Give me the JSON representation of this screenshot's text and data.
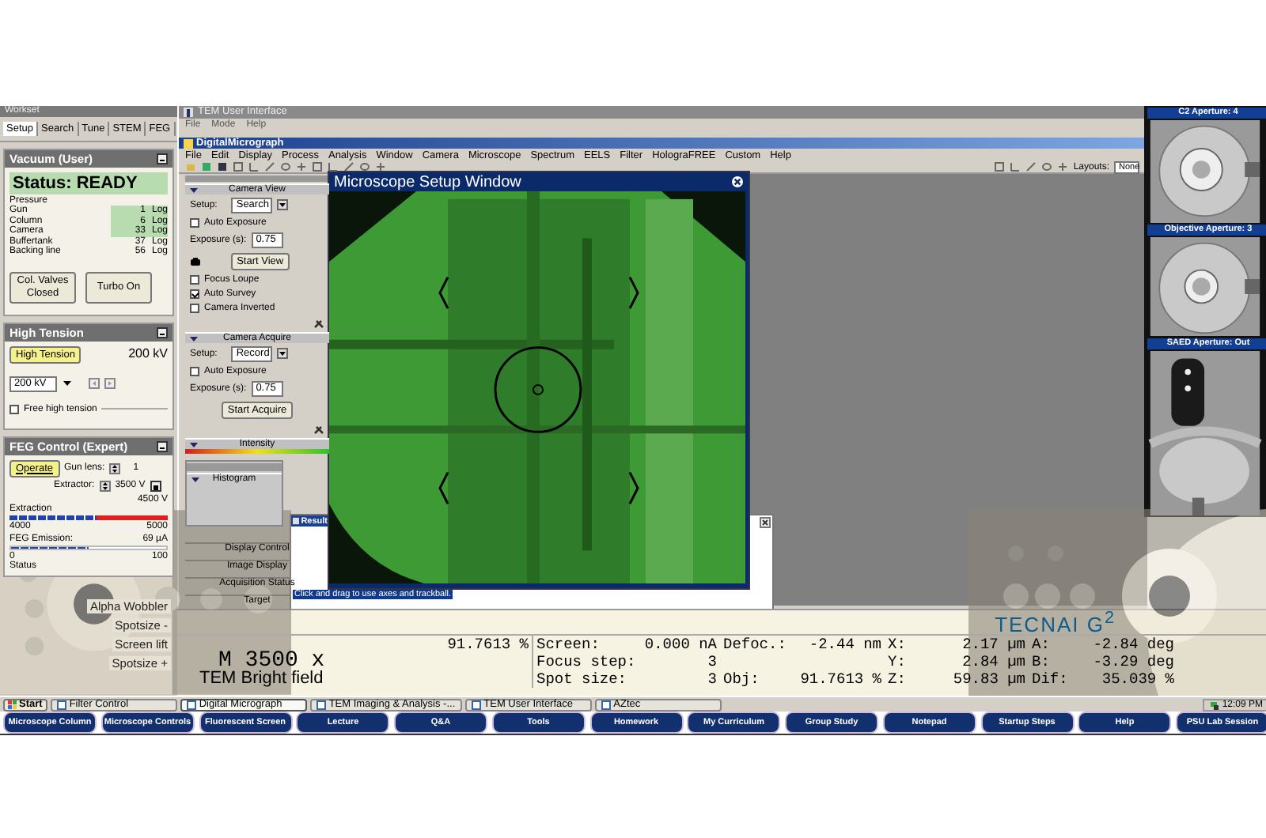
{
  "workset": {
    "title": "Workset",
    "tabs": [
      {
        "label": "Setup",
        "selected": true
      },
      {
        "label": "Search",
        "selected": false
      },
      {
        "label": "Tune",
        "selected": false
      },
      {
        "label": "STEM",
        "selected": false
      },
      {
        "label": "FEG",
        "selected": false
      }
    ]
  },
  "vacuum": {
    "title": "Vacuum (User)",
    "status": "Status:  READY",
    "pressure_label": "Pressure",
    "gauges": [
      {
        "name": "Gun",
        "value": "1",
        "unit": "Log",
        "highlighted": true
      },
      {
        "name": "Column",
        "value": "6",
        "unit": "Log",
        "highlighted": true
      },
      {
        "name": "Camera",
        "value": "33",
        "unit": "Log",
        "highlighted": true
      },
      {
        "name": "Buffertank",
        "value": "37",
        "unit": "Log",
        "highlighted": false
      },
      {
        "name": "Backing line",
        "value": "56",
        "unit": "Log",
        "highlighted": false
      }
    ],
    "buttons": [
      "Col. Valves Closed",
      "Turbo On"
    ]
  },
  "high_tension": {
    "title": "High Tension",
    "button": {
      "label": "High Tension",
      "on": true
    },
    "reading": "200 kV",
    "select": "200 kV",
    "free_tension": {
      "label": "Free high tension",
      "checked": false
    }
  },
  "feg": {
    "title": "FEG Control (Expert)",
    "operate": {
      "label": "Operate",
      "on": true
    },
    "gun_lens_label": "Gun lens:",
    "gun_lens": "1",
    "extractor_label": "Extractor:",
    "extractor": "3500 V",
    "extraction_max": "4500 V",
    "extraction": {
      "label": "Extraction",
      "level": 0.55,
      "min": "4000",
      "max": "5000"
    },
    "emission": {
      "label": "FEG Emission:",
      "reading": "69 µA",
      "level": 0.5,
      "min": "0",
      "max": "100"
    },
    "status_label": "Status",
    "flap_buttons": [
      "Alpha Wobbler",
      "Spotsize -",
      "Screen lift",
      "Spotsize +"
    ]
  },
  "tem_ui": {
    "title": "TEM User Interface",
    "menu": [
      "File",
      "Mode",
      "Help"
    ]
  },
  "dm": {
    "title": "DigitalMicrograph",
    "menu": [
      "File",
      "Edit",
      "Display",
      "Process",
      "Analysis",
      "Window",
      "Camera",
      "Microscope",
      "Spectrum",
      "EELS",
      "Filter",
      "HolograFREE",
      "Custom",
      "Help"
    ],
    "layouts_label": "Layouts:",
    "layout": "None",
    "camera_view": {
      "title": "Camera View",
      "setup_label": "Setup:",
      "setup": "Search",
      "exposure_label": "Exposure (s):",
      "exposure": "0.75",
      "button": "Start View",
      "checks": [
        {
          "label": "Auto Exposure",
          "checked": false,
          "kind": "top"
        },
        {
          "label": "Focus Loupe",
          "checked": false,
          "kind": "bottom"
        },
        {
          "label": "Auto Survey",
          "checked": true,
          "kind": "bottom"
        },
        {
          "label": "Camera Inverted",
          "checked": false,
          "kind": "bottom"
        }
      ]
    },
    "camera_acquire": {
      "title": "Camera Acquire",
      "setup_label": "Setup:",
      "setup": "Record",
      "exposure_label": "Exposure (s):",
      "exposure": "0.75",
      "button": "Start Acquire",
      "checks": [
        {
          "label": "Auto Exposure",
          "checked": false,
          "kind": "top"
        }
      ]
    },
    "intensity_title": "Intensity",
    "histogram_title": "Histogram",
    "palettes": [
      "Display Control",
      "Image Display",
      "Acquisition Status",
      "Target"
    ]
  },
  "setup_window": {
    "title": "Microscope Setup Window"
  },
  "result_window": {
    "title": "Result",
    "hint": "Click and drag to use axes and trackball."
  },
  "apertures": [
    {
      "label": "C2 Aperture: 4"
    },
    {
      "label": "Objective Aperture: 3"
    },
    {
      "label": "SAED Aperture: Out"
    }
  ],
  "readout": {
    "brand": "TECNAI G$^{2}$",
    "magnification": "M 3500 x",
    "mode": "TEM Bright field",
    "intensity": "91.7613 %",
    "rows": [
      [
        {
          "label": "Screen:",
          "value": "0.000 nA"
        },
        {
          "label": "Defoc.:",
          "value": "-2.44 nm"
        },
        {
          "label": "X:",
          "value": "2.17 µm"
        },
        {
          "label": "A:",
          "value": "-2.84 deg"
        }
      ],
      [
        {
          "label": "Focus step:",
          "value": "3"
        },
        null,
        {
          "label": "Y:",
          "value": "2.84 µm"
        },
        {
          "label": "B:",
          "value": "-3.29 deg"
        }
      ],
      [
        {
          "label": "Spot size:",
          "value": "3"
        },
        {
          "label": "Obj:",
          "value": "91.7613 %"
        },
        {
          "label": "Z:",
          "value": "59.83 µm"
        },
        {
          "label": "Dif:",
          "value": "35.039 %"
        }
      ]
    ]
  },
  "taskbar": {
    "start": "Start",
    "tasks": [
      {
        "label": "Filter Control",
        "selected": false
      },
      {
        "label": "Digital Micrograph",
        "selected": true
      },
      {
        "label": "TEM Imaging & Analysis -...",
        "selected": false
      },
      {
        "label": "TEM User Interface",
        "selected": false
      },
      {
        "label": "AZtec",
        "selected": false
      }
    ],
    "clock": "12:09 PM"
  },
  "nav": [
    "Microscope Column",
    "Microscope Controls",
    "Fluorescent Screen",
    "Lecture",
    "Q&A",
    "Tools",
    "Homework",
    "My Curriculum",
    "Group Study",
    "Notepad",
    "Startup Steps",
    "Help",
    "PSU Lab Session"
  ]
}
